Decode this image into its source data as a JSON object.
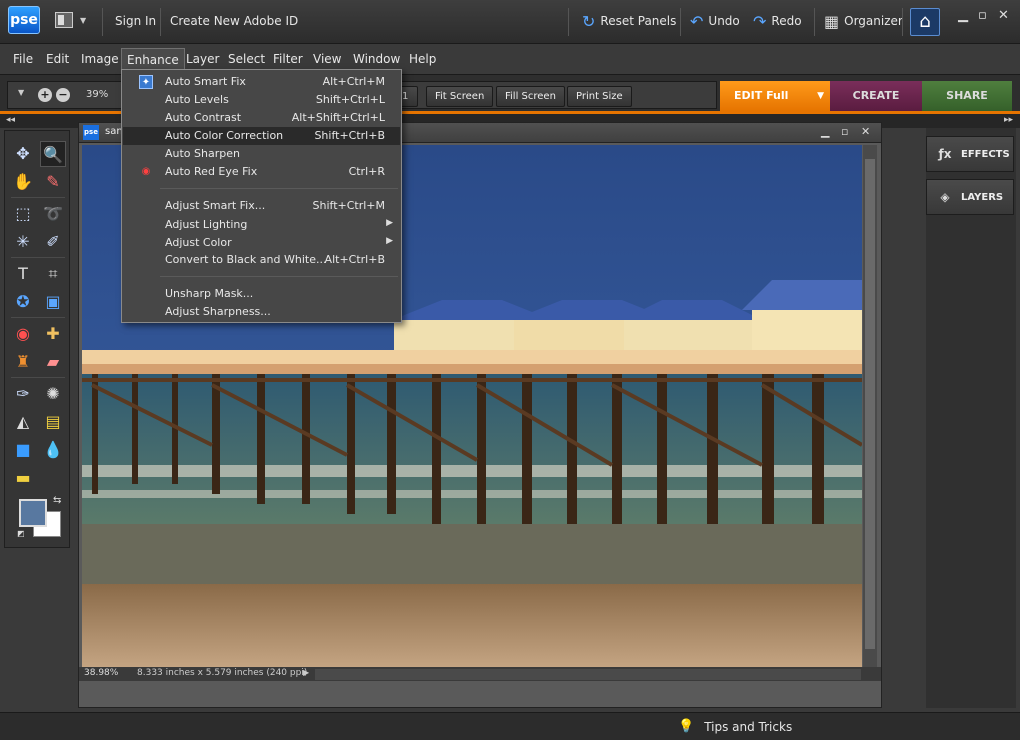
{
  "titlebar": {
    "logo": "pse",
    "sign_in": "Sign In",
    "create_id": "Create New Adobe ID",
    "reset_panels": "Reset Panels",
    "undo": "Undo",
    "redo": "Redo",
    "organizer": "Organizer"
  },
  "menubar": {
    "file": "File",
    "edit": "Edit",
    "image": "Image",
    "enhance": "Enhance",
    "layer": "Layer",
    "select": "Select",
    "filter": "Filter",
    "view": "View",
    "window": "Window",
    "help": "Help"
  },
  "options": {
    "zoom_value": "39%",
    "fit_screen": "Fit Screen",
    "fill_screen": "Fill Screen",
    "print_size": "Print Size",
    "actual_pixels_tail": "1"
  },
  "mode_tabs": {
    "edit": "EDIT Full",
    "create": "CREATE",
    "share": "SHARE"
  },
  "enhance_menu": {
    "items": [
      {
        "label": "Auto Smart Fix",
        "shortcut": "Alt+Ctrl+M"
      },
      {
        "label": "Auto Levels",
        "shortcut": "Shift+Ctrl+L"
      },
      {
        "label": "Auto Contrast",
        "shortcut": "Alt+Shift+Ctrl+L"
      },
      {
        "label": "Auto Color Correction",
        "shortcut": "Shift+Ctrl+B"
      },
      {
        "label": "Auto Sharpen",
        "shortcut": ""
      },
      {
        "label": "Auto Red Eye Fix",
        "shortcut": "Ctrl+R"
      },
      {
        "label": "Adjust Smart Fix...",
        "shortcut": "Shift+Ctrl+M"
      },
      {
        "label": "Adjust Lighting",
        "shortcut": ""
      },
      {
        "label": "Adjust Color",
        "shortcut": ""
      },
      {
        "label": "Convert to Black and White...",
        "shortcut": "Alt+Ctrl+B"
      },
      {
        "label": "Unsharp Mask...",
        "shortcut": ""
      },
      {
        "label": "Adjust Sharpness...",
        "shortcut": ""
      }
    ]
  },
  "document": {
    "icon_text": "pse",
    "title": "san",
    "zoom_status": "38.98%",
    "size_status": "8.333 inches x 5.579 inches (240 ppi)"
  },
  "panels": {
    "effects": "EFFECTS",
    "layers": "LAYERS"
  },
  "footer": {
    "tips": "Tips and Tricks"
  },
  "colors": {
    "accent_edit": "#e67400",
    "accent_create": "#6a2450",
    "accent_share": "#426f33",
    "foreground_swatch": "#5878a0",
    "background_swatch": "#ffffff"
  }
}
